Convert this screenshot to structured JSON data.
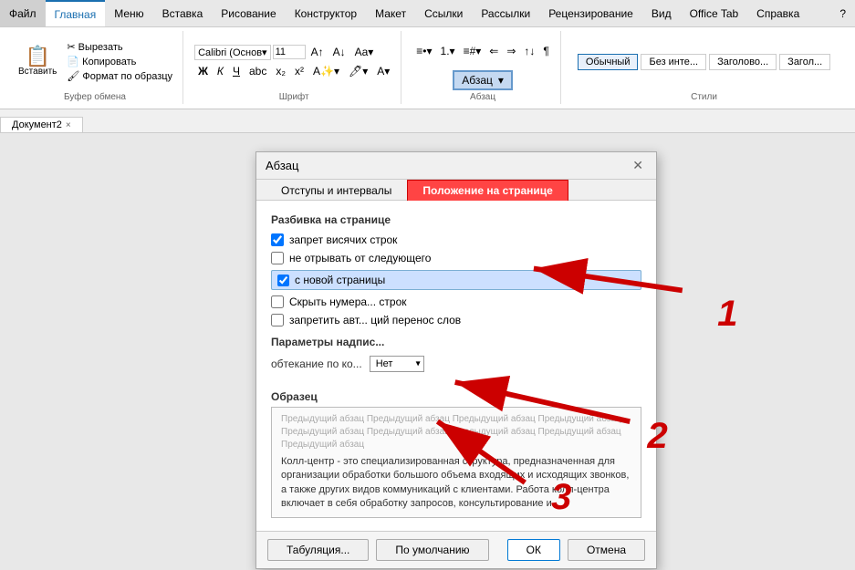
{
  "menubar": {
    "items": [
      "Файл",
      "Главная",
      "Меню",
      "Вставка",
      "Рисование",
      "Конструктор",
      "Макет",
      "Ссылки",
      "Рассылки",
      "Рецензирование",
      "Вид",
      "Office Tab",
      "Справка"
    ],
    "active": "Главная",
    "help_icon": "?"
  },
  "ribbon": {
    "groups": [
      {
        "label": "Буфер обмена",
        "items": [
          "Вставить",
          "Вырезать",
          "Копировать",
          "Формат по образцу"
        ]
      },
      {
        "label": "Шрифт",
        "font": "Calibri (Основ▾",
        "size": "11",
        "items": [
          "Ж",
          "К",
          "Ч",
          "abc",
          "x₂",
          "x²"
        ]
      },
      {
        "label": "Абзац"
      },
      {
        "label": "Стили"
      }
    ]
  },
  "abzac_section": {
    "label": "Абзац",
    "arrow": "▾"
  },
  "document_tab": {
    "name": "Документ2",
    "close": "×"
  },
  "dialog": {
    "title": "Абзац",
    "close_btn": "✕",
    "tabs": [
      {
        "label": "Отступы и интервалы",
        "active": false
      },
      {
        "label": "Положение на странице",
        "active": true,
        "highlighted": true
      }
    ],
    "section_pagination": {
      "title": "Разбивка на странице",
      "checkboxes": [
        {
          "label": "запрет висячих строк",
          "checked": true
        },
        {
          "label": "не отрывать от следующего",
          "checked": false
        },
        {
          "label": "с новой страницы",
          "checked": true,
          "highlighted": true
        },
        {
          "label": "Скрыть нумера... строк",
          "checked": false
        },
        {
          "label": "запретить авт... ций перенос слов",
          "checked": false
        }
      ]
    },
    "section_nadpis": {
      "title": "Параметры надпис...",
      "label": "обтекание по ко...",
      "select_value": "Нет"
    },
    "sample": {
      "label": "Образец",
      "prev_text": "Предыдущий абзац Предыдущий абзац Предыдущий абзац Предыдущий абзац Предыдущий абзац Предыдущий абзац Предыдущий абзац Предыдущий абзац Предыдущий абзац",
      "main_text": "Колл-центр - это специализированная структура, предназначенная для организации обработки большого объема входящих и исходящих звонков, а также других видов коммуникаций с клиентами. Работа колл-центра включает в себя обработку запросов, консультирование и"
    },
    "footer": {
      "btn_tabulyatsiya": "Табуляция...",
      "btn_default": "По умолчанию",
      "btn_ok": "ОК",
      "btn_cancel": "Отмена"
    }
  },
  "annotations": {
    "number1": "1",
    "number2": "2",
    "number3": "3"
  },
  "styles": {
    "items": [
      "Обычный",
      "Без инте...",
      "Заголово...",
      "Загол..."
    ]
  }
}
